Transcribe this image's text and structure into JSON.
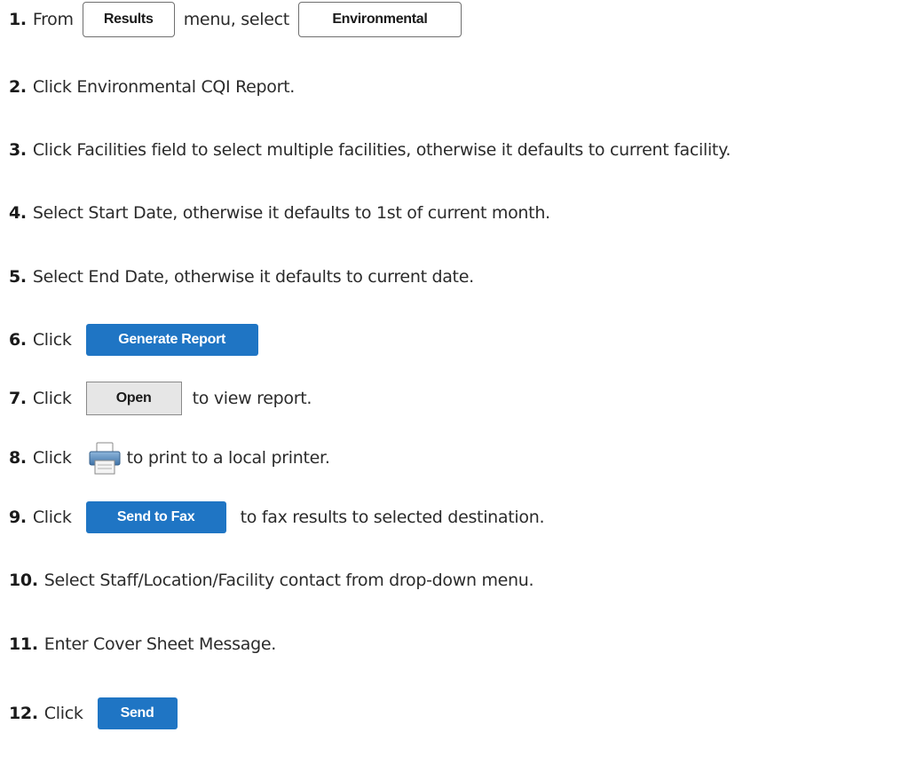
{
  "steps": [
    {
      "num": "1.",
      "parts": [
        "From",
        "menu, select"
      ],
      "buttons": [
        "Results",
        "Environmental"
      ]
    },
    {
      "num": "2.",
      "text": "Click Environmental CQI Report."
    },
    {
      "num": "3.",
      "text": "Click Facilities field to select multiple facilities, otherwise it defaults to current facility."
    },
    {
      "num": "4.",
      "text": "Select Start Date, otherwise it defaults to 1st of current month."
    },
    {
      "num": "5.",
      "text": "Select End Date, otherwise it defaults to current date."
    },
    {
      "num": "6.",
      "pre": "Click",
      "button": "Generate Report"
    },
    {
      "num": "7.",
      "pre": "Click",
      "button": "Open",
      "post": "to view report."
    },
    {
      "num": "8.",
      "pre": "Click",
      "icon": "printer-icon",
      "post": "to print to a local printer."
    },
    {
      "num": "9.",
      "pre": "Click",
      "button": "Send to Fax",
      "post": "to  fax results to selected destination."
    },
    {
      "num": "10.",
      "text": "Select Staff/Location/Facility contact from drop-down menu."
    },
    {
      "num": "11.",
      "text": "Enter Cover Sheet Message."
    },
    {
      "num": "12.",
      "pre": "Click",
      "button": "Send"
    }
  ],
  "colors": {
    "accent_blue": "#1f75c4",
    "open_button_bg": "#e6e6e6",
    "text": "#2b2b2b"
  }
}
